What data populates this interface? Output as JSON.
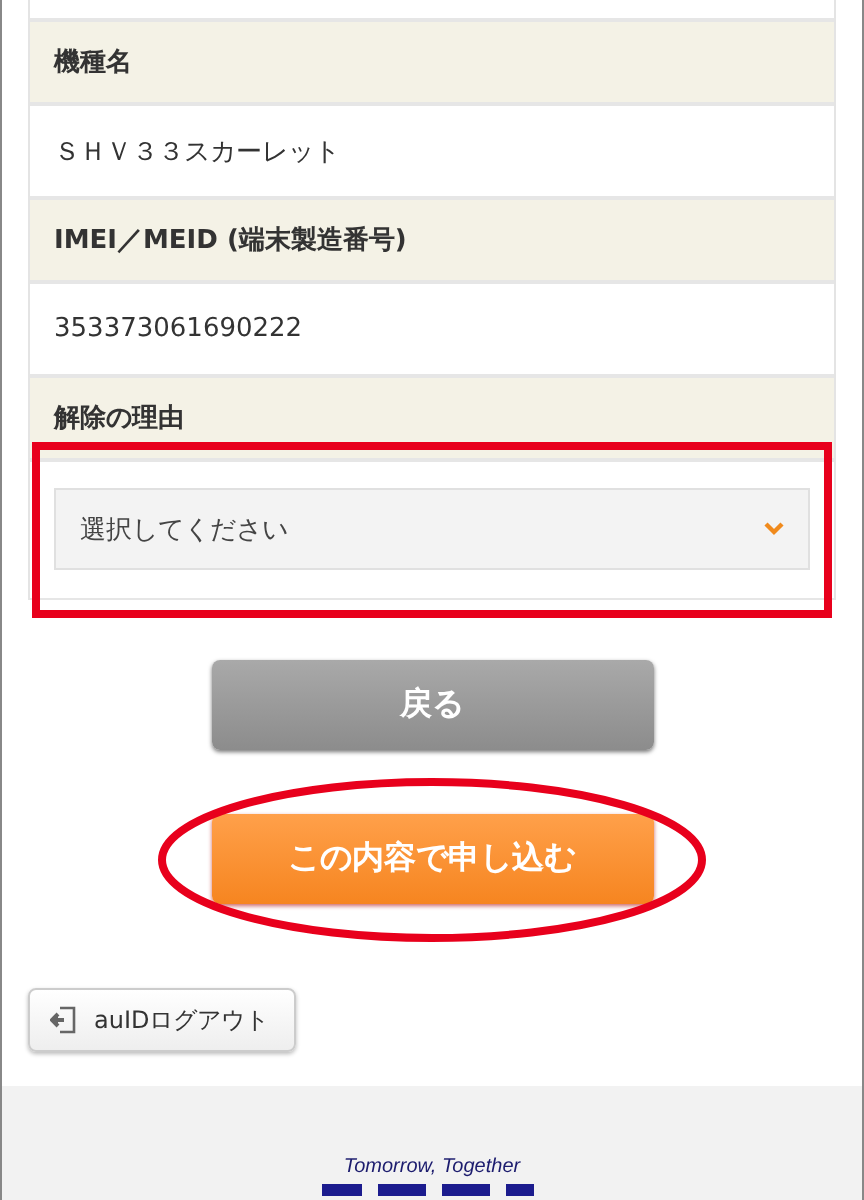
{
  "fields": [
    {
      "kind": "text",
      "label": "機種名",
      "value": "ＳＨＶ３３スカーレット"
    },
    {
      "kind": "text",
      "label": "IMEI／MEID (端末製造番号)",
      "value": "353373061690222"
    },
    {
      "kind": "select",
      "label": "解除の理由",
      "placeholder": "選択してください"
    }
  ],
  "buttons": [
    {
      "kind": "back",
      "label": "戻る"
    },
    {
      "kind": "submit",
      "label": "この内容で申し込む"
    }
  ],
  "logout_button": {
    "label": "auIDログアウト"
  },
  "footer": {
    "tagline": "Tomorrow, Together"
  },
  "annotations": [
    {
      "kind": "rectangle"
    },
    {
      "kind": "ellipse"
    }
  ]
}
